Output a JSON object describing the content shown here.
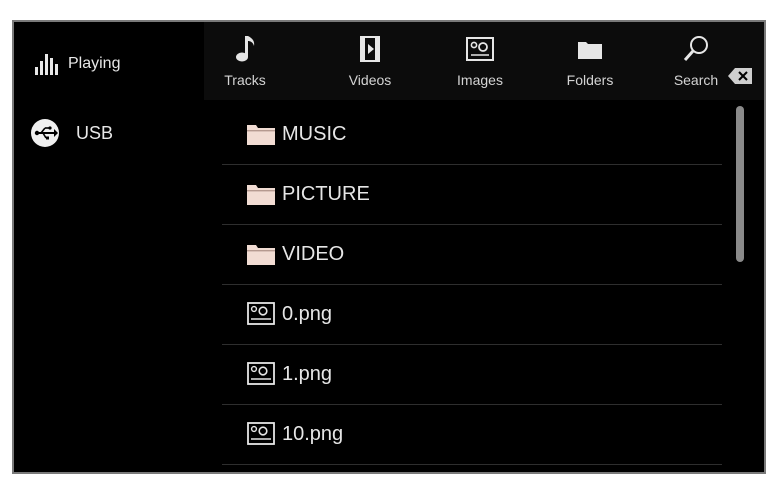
{
  "sidebar": {
    "playing_label": "Playing",
    "usb_label": "USB"
  },
  "toolbar": {
    "tabs": [
      {
        "label": "Tracks",
        "icon": "music-note-icon"
      },
      {
        "label": "Videos",
        "icon": "film-icon"
      },
      {
        "label": "Images",
        "icon": "image-icon"
      },
      {
        "label": "Folders",
        "icon": "folder-icon"
      },
      {
        "label": "Search",
        "icon": "search-icon"
      }
    ],
    "backspace_icon": "backspace-icon"
  },
  "files": [
    {
      "name": "MUSIC",
      "icon": "folder-icon"
    },
    {
      "name": "PICTURE",
      "icon": "folder-icon"
    },
    {
      "name": "VIDEO",
      "icon": "folder-icon"
    },
    {
      "name": "0.png",
      "icon": "image-file-icon"
    },
    {
      "name": "1.png",
      "icon": "image-file-icon"
    },
    {
      "name": "10.png",
      "icon": "image-file-icon"
    }
  ],
  "colors": {
    "background": "#000000",
    "text": "#e6e6e6",
    "folder_icon": "#f1dcd3",
    "divider": "#2e2e2e",
    "scrollbar": "#8a8a8a"
  }
}
